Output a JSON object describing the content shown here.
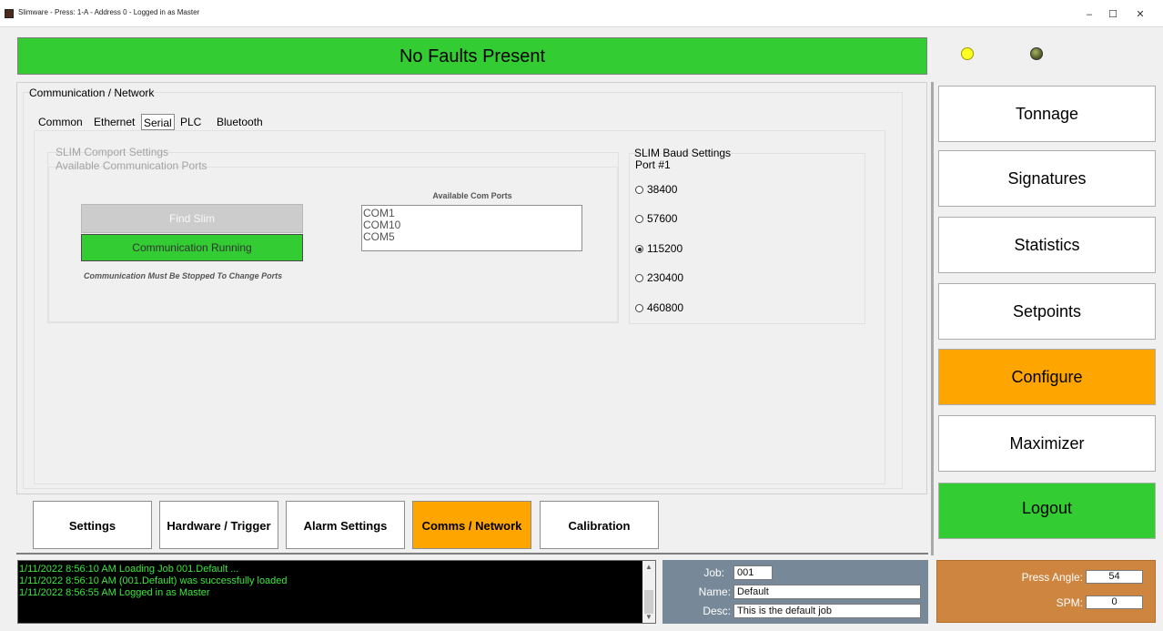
{
  "window": {
    "title": "Slimware - Press: 1-A - Address 0 - Logged in as Master",
    "minimize": "–",
    "maximize": "☐",
    "close": "✕"
  },
  "fault_banner": {
    "text": "No Faults Present",
    "color": "#33cc33"
  },
  "indicators": [
    {
      "name": "yellow-led",
      "color": "#ffff00"
    },
    {
      "name": "olive-led",
      "color": "#556b2f"
    }
  ],
  "communication": {
    "title": "Communication / Network",
    "tabs": [
      "Common",
      "Ethernet",
      "Serial",
      "PLC",
      "Bluetooth"
    ],
    "active_tab": "Serial",
    "comport_group": {
      "title": "SLIM Comport Settings",
      "ports_title": "Available Communication Ports",
      "find_button": "Find Slim",
      "running_button": "Communication Running",
      "note": "Communication Must Be Stopped To Change Ports",
      "com_ports_label": "Available Com Ports",
      "com_ports": [
        "COM1",
        "COM10",
        "COM5"
      ]
    },
    "baud_group": {
      "title": "SLIM Baud Settings",
      "port_label": "Port #1",
      "options": [
        "38400",
        "57600",
        "115200",
        "230400",
        "460800"
      ],
      "selected": "115200"
    }
  },
  "nav": {
    "buttons": [
      "Tonnage",
      "Signatures",
      "Statistics",
      "Setpoints",
      "Configure",
      "Maximizer",
      "Logout"
    ],
    "active": "Configure",
    "colors": {
      "active": "#ffa500",
      "logout": "#33cc33",
      "default": "#ffffff"
    }
  },
  "bottom_tabs": {
    "buttons": [
      "Settings",
      "Hardware / Trigger",
      "Alarm Settings",
      "Comms / Network",
      "Calibration"
    ],
    "active": "Comms / Network"
  },
  "log": {
    "lines": [
      "1/11/2022 8:56:10 AM  Loading Job 001.Default ...",
      "1/11/2022 8:56:10 AM  (001.Default) was successfully loaded",
      "1/11/2022 8:56:55 AM  Logged in as Master"
    ],
    "text_color": "#3ce63c"
  },
  "job": {
    "job_label": "Job:",
    "job_value": "001",
    "name_label": "Name:",
    "name_value": "Default",
    "desc_label": "Desc:",
    "desc_value": "This is the default job"
  },
  "press": {
    "angle_label": "Press Angle:",
    "angle_value": "54",
    "spm_label": "SPM:",
    "spm_value": "0"
  }
}
